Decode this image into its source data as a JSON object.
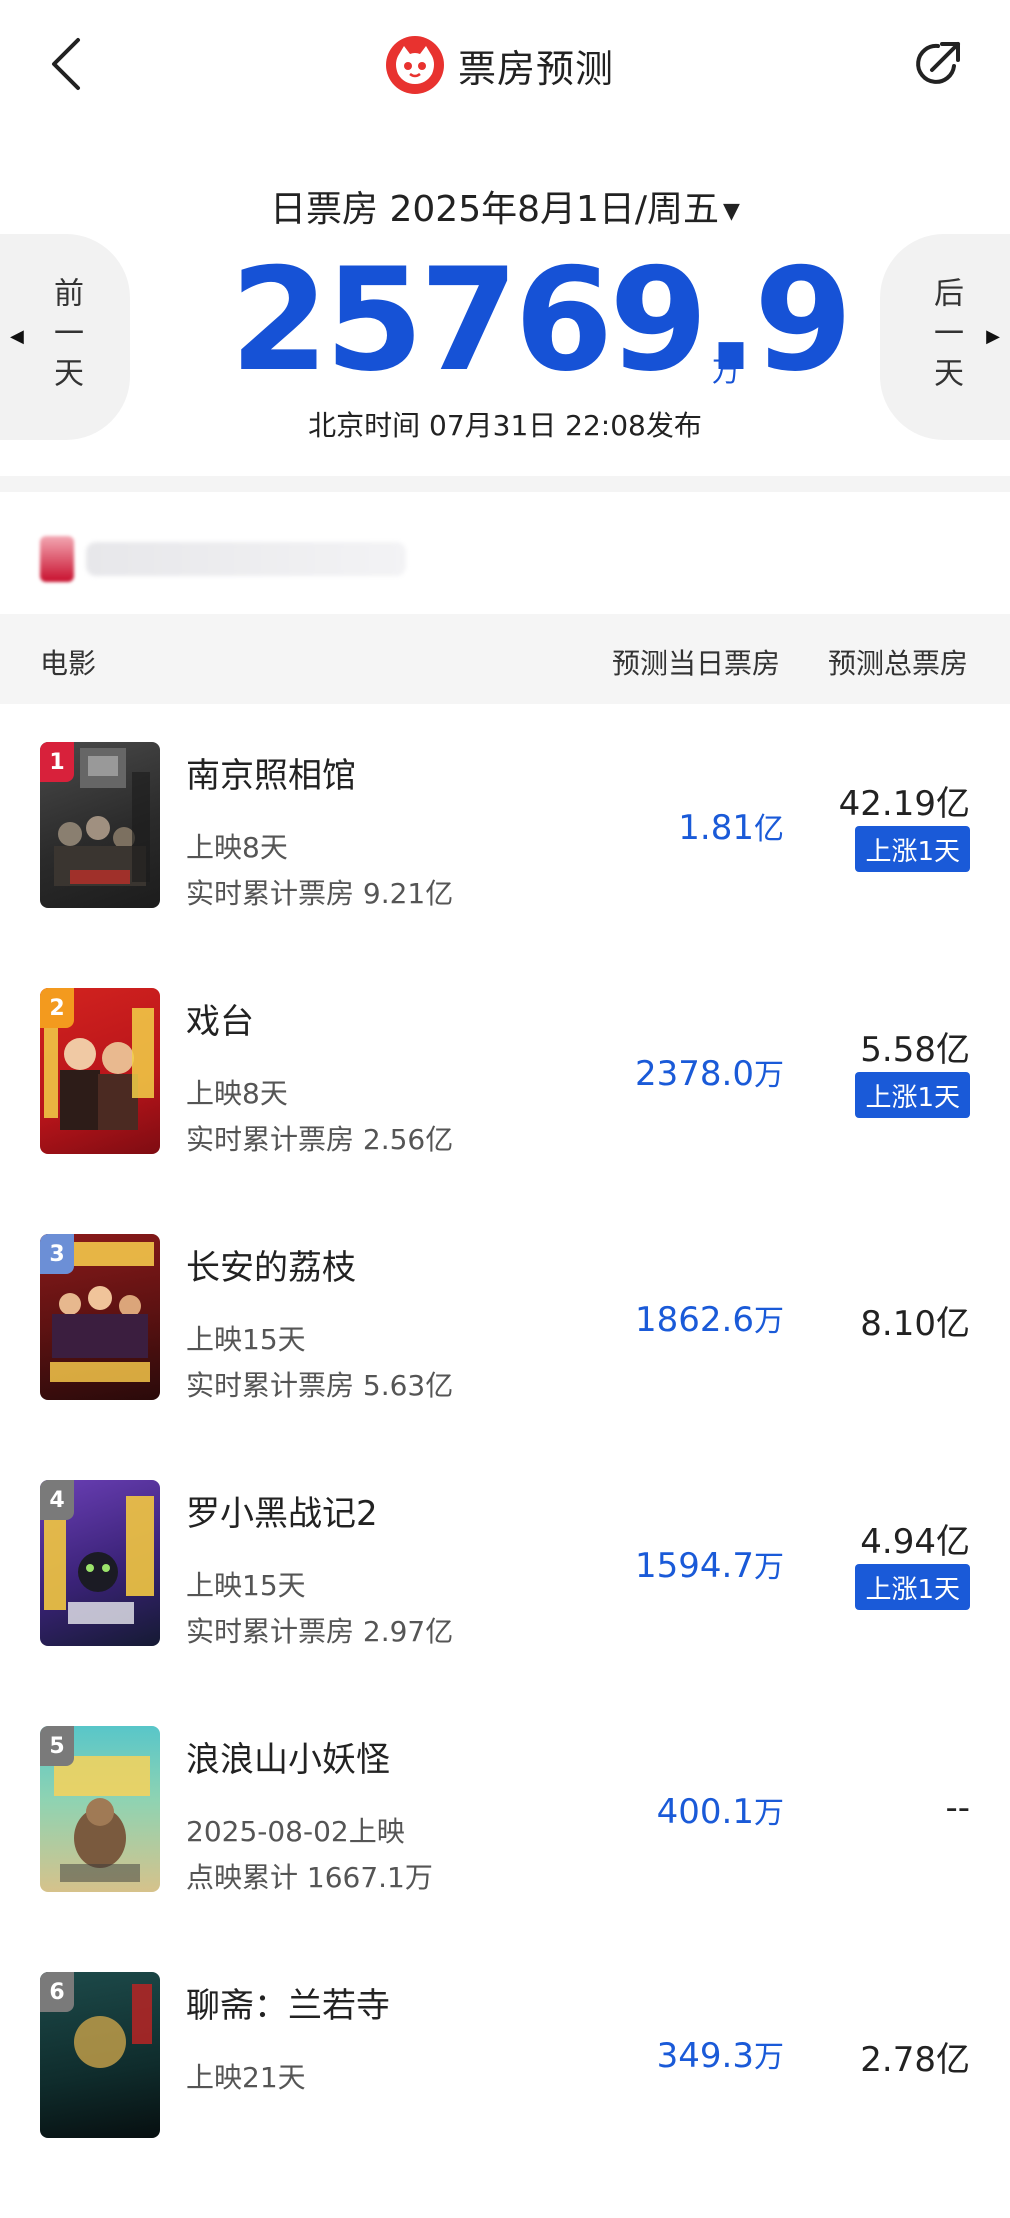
{
  "header": {
    "title": "票房预测",
    "icons": [
      "back-icon",
      "maoyan-logo-icon",
      "share-icon"
    ]
  },
  "summary": {
    "date_label": "日票房 2025年8月1日/周五",
    "prev_label": "前一天",
    "next_label": "后一天",
    "total": "25769.9",
    "unit": "万",
    "publish_time": "北京时间  07月31日  22:08发布"
  },
  "table": {
    "col_movie": "电影",
    "col_today": "预测当日票房",
    "col_total": "预测总票房"
  },
  "colors": {
    "accent": "#1a5ad8",
    "big_number": "#1652d6",
    "logo": "#e8322f",
    "rank1": "#d8213b",
    "rank2": "#f39a1e",
    "rank3": "#6c8fd6",
    "rank_other": "#7a7a7a"
  },
  "movies": [
    {
      "rank": "1",
      "name": "南京照相馆",
      "sub1": "上映8天",
      "sub2": "实时累计票房 9.21亿",
      "today_value": "1.81",
      "today_unit": "亿",
      "total": "42.19亿",
      "badge": "上涨1天"
    },
    {
      "rank": "2",
      "name": "戏台",
      "sub1": "上映8天",
      "sub2": "实时累计票房 2.56亿",
      "today_value": "2378.0",
      "today_unit": "万",
      "total": "5.58亿",
      "badge": "上涨1天"
    },
    {
      "rank": "3",
      "name": "长安的荔枝",
      "sub1": "上映15天",
      "sub2": "实时累计票房 5.63亿",
      "today_value": "1862.6",
      "today_unit": "万",
      "total": "8.10亿",
      "badge": ""
    },
    {
      "rank": "4",
      "name": "罗小黑战记2",
      "sub1": "上映15天",
      "sub2": "实时累计票房 2.97亿",
      "today_value": "1594.7",
      "today_unit": "万",
      "total": "4.94亿",
      "badge": "上涨1天"
    },
    {
      "rank": "5",
      "name": "浪浪山小妖怪",
      "sub1": "2025-08-02上映",
      "sub2": "点映累计 1667.1万",
      "today_value": "400.1",
      "today_unit": "万",
      "total": "--",
      "badge": ""
    },
    {
      "rank": "6",
      "name": "聊斋：兰若寺",
      "sub1": "上映21天",
      "sub2": "",
      "today_value": "349.3",
      "today_unit": "万",
      "total": "2.78亿",
      "badge": ""
    }
  ]
}
